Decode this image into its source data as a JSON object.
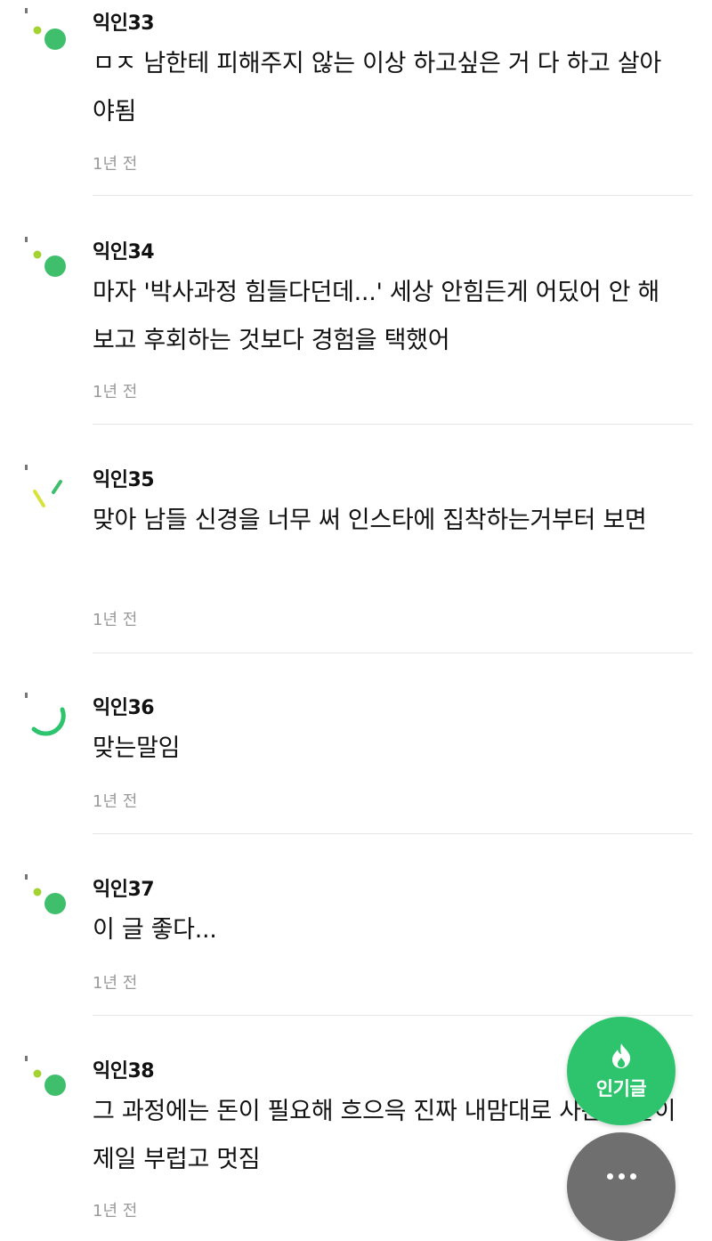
{
  "colors": {
    "accent_green": "#2ec46d",
    "avatar_green": "#3fbf6b",
    "avatar_lime": "#a5d233",
    "more_gray": "#6f6f6f",
    "time_gray": "#9a9a9a"
  },
  "comments": [
    {
      "author": "익인33",
      "body": "ㅁㅈ 남한테 피해주지 않는 이상 하고싶은 거 다 하고 살아야됨",
      "time": "1년 전",
      "avatar_icon": "dots-avatar-icon"
    },
    {
      "author": "익인34",
      "body": "마자 '박사과정 힘들다던데...' 세상 안힘든게 어딨어 안 해보고 후회하는 것보다 경험을 택했어",
      "time": "1년 전",
      "avatar_icon": "dots-avatar-icon"
    },
    {
      "author": "익인35",
      "body": "맞아 남들 신경을 너무 써 인스타에 집착하는거부터 보면",
      "time": "1년 전",
      "avatar_icon": "lines-avatar-icon"
    },
    {
      "author": "익인36",
      "body": "맞는말임",
      "time": "1년 전",
      "avatar_icon": "arc-avatar-icon"
    },
    {
      "author": "익인37",
      "body": "이 글 좋다...",
      "time": "1년 전",
      "avatar_icon": "dots-avatar-icon"
    },
    {
      "author": "익인38",
      "body": "그 과정에는 돈이 필요해 흐으윽 진짜 내맘대로 사는 애들이 제일 부럽고 멋짐",
      "time": "1년 전",
      "avatar_icon": "dots-avatar-icon"
    }
  ],
  "fab": {
    "popular_label": "인기글",
    "popular_icon": "fire-icon",
    "more_icon": "more-dots-icon"
  }
}
